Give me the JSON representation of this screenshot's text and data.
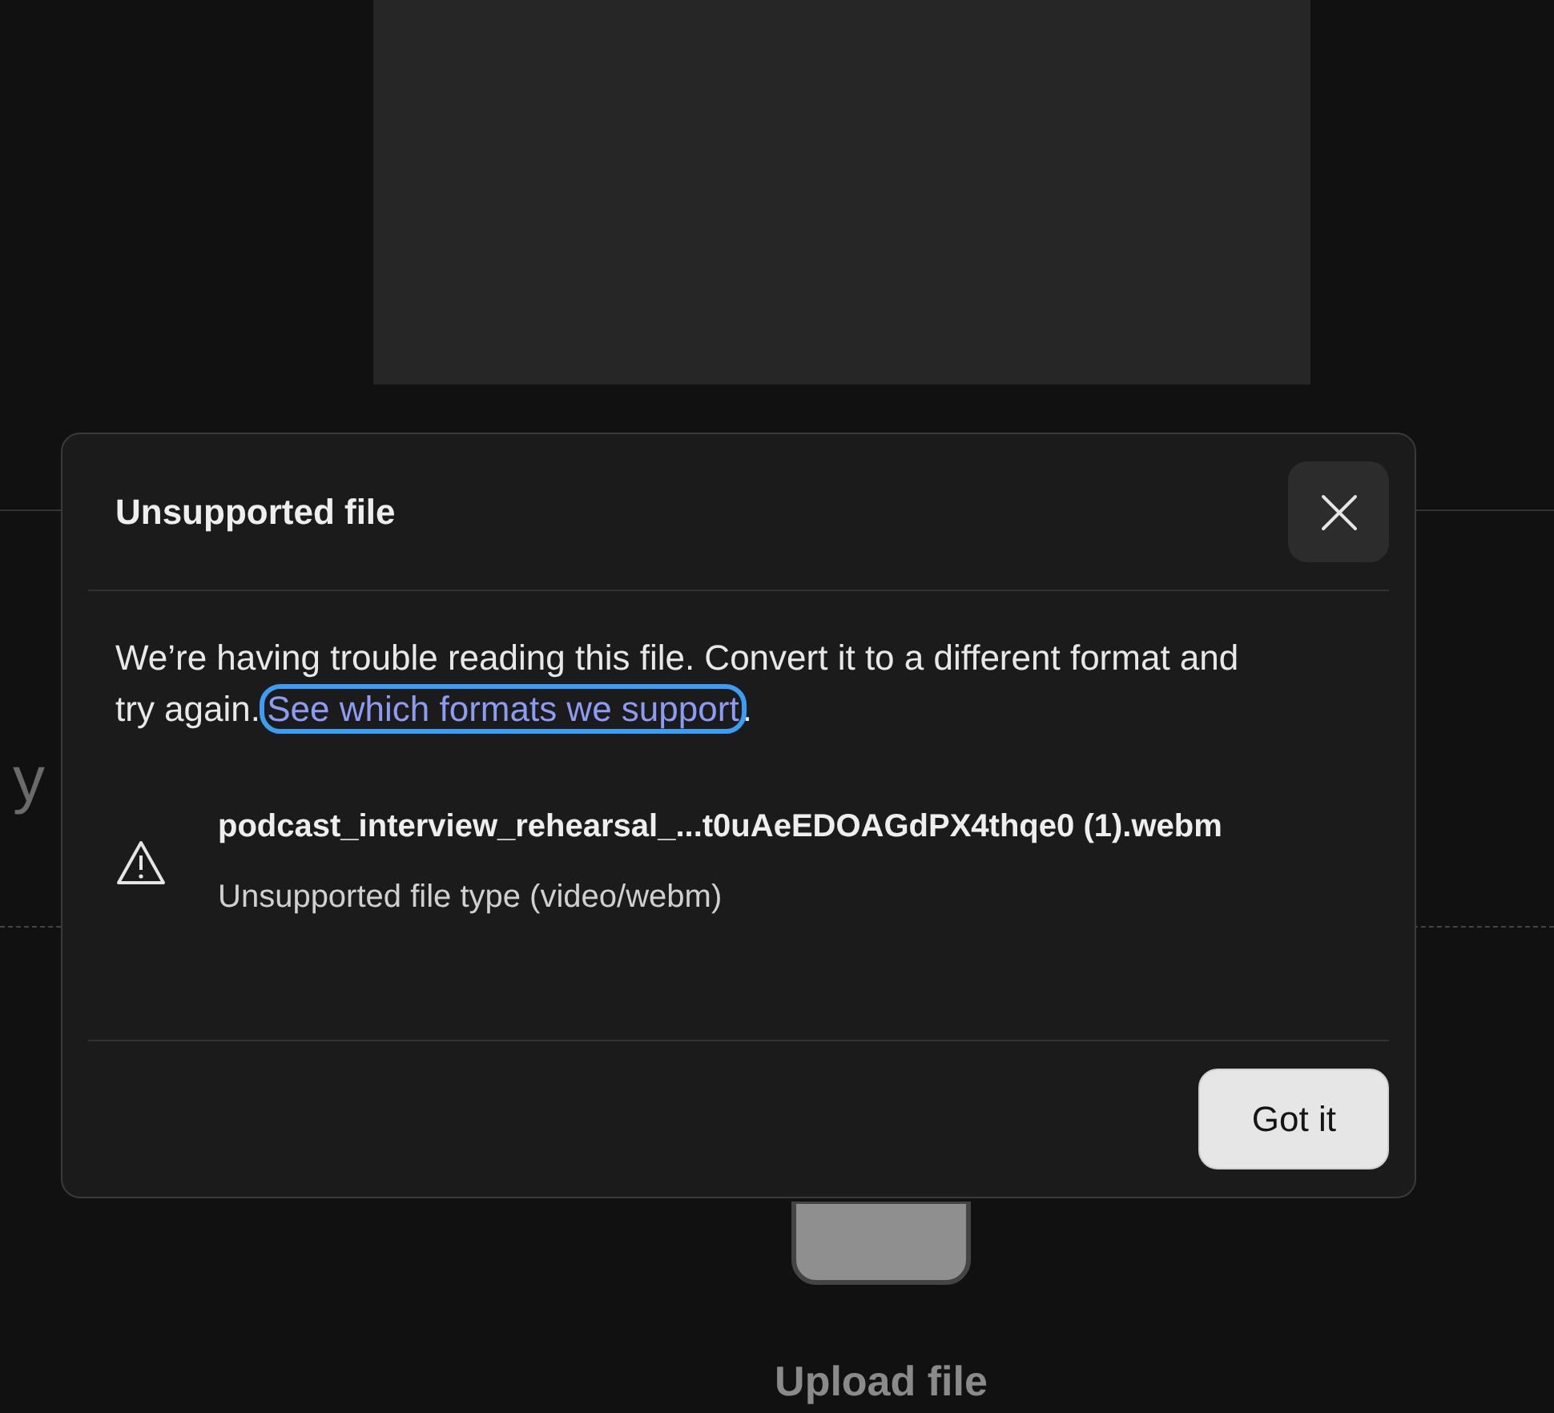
{
  "background": {
    "heading_fragment": "y",
    "upload_label": "Upload file"
  },
  "dialog": {
    "title": "Unsupported file",
    "message": "We’re having trouble reading this file. Convert it to a different format and try again.",
    "link": {
      "label": "See which formats we support",
      "focused": true
    },
    "link_end": ".",
    "files": [
      {
        "name": "podcast_interview_rehearsal_...t0uAeEDOAGdPX4thqe0 (1).webm",
        "status": "Unsupported file type (video/webm)"
      }
    ],
    "buttons": [
      {
        "label": "Got it"
      }
    ]
  }
}
